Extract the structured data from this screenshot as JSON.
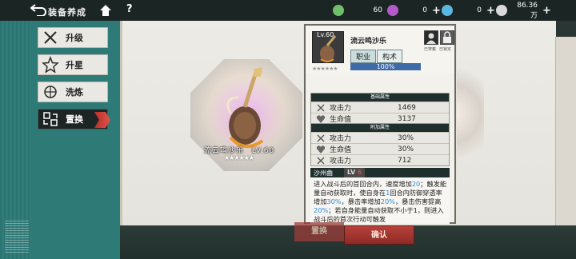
{
  "topbar": {
    "title": "装备养成",
    "help": "?",
    "resources": [
      {
        "name": "jade",
        "value": "60",
        "color": "#6fbf6a"
      },
      {
        "name": "token",
        "value": "0",
        "color": "#b25ac9"
      },
      {
        "name": "gem",
        "value": "0",
        "color": "#5cb7e0"
      },
      {
        "name": "coin",
        "value": "86.36万",
        "color": "#d9d9d9"
      }
    ],
    "plus": "+"
  },
  "sidebar": {
    "items": [
      {
        "label": "升级",
        "icon": "crossed-swords-icon",
        "active": false
      },
      {
        "label": "升星",
        "icon": "star-icon",
        "active": false
      },
      {
        "label": "洗炼",
        "icon": "refine-icon",
        "active": false
      },
      {
        "label": "置换",
        "icon": "swap-icon",
        "active": true
      }
    ]
  },
  "preview": {
    "name": "流云鸣沙乐",
    "level": "LV.60",
    "stars": "★★★★★★"
  },
  "panel": {
    "level": "Lv.60",
    "name": "流云鸣沙乐",
    "job_label": "职业",
    "job_value": "构术",
    "progress_text": "100%",
    "progress": 1.0,
    "avatars": [
      {
        "caption": "已穿戴"
      },
      {
        "caption": "已锁定"
      }
    ],
    "base_title": "基础属性",
    "base_stats": [
      {
        "name": "攻击力",
        "value": "1469",
        "icon": "sword-icon"
      },
      {
        "name": "生命值",
        "value": "3137",
        "icon": "heart-icon"
      }
    ],
    "extra_title": "附加属性",
    "extra_stats": [
      {
        "name": "攻击力",
        "value": "30%",
        "icon": "sword-icon"
      },
      {
        "name": "生命值",
        "value": "30%",
        "icon": "heart-icon"
      },
      {
        "name": "攻击力",
        "value": "712",
        "icon": "sword-icon"
      }
    ],
    "skill_name": "沙州曲",
    "skill_level_prefix": "LV ",
    "skill_level": "6",
    "skill_desc": [
      {
        "t": "进入战斗后的首回合内，速度增加"
      },
      {
        "t": "20",
        "hl": true
      },
      {
        "t": "；触发能量自动获取时，使自身在"
      },
      {
        "t": "1",
        "hl": true
      },
      {
        "t": "回合内防御穿透率增加"
      },
      {
        "t": "30%",
        "hl": true
      },
      {
        "t": "，暴击率增加"
      },
      {
        "t": "20%",
        "hl": true
      },
      {
        "t": "，暴击伤害提高"
      },
      {
        "t": "20%",
        "hl": true
      },
      {
        "t": "；若自身能量自动获取不小于"
      },
      {
        "t": "",
        "hl": false
      },
      {
        "t": "1，则进入战斗后的首次行动可触发"
      }
    ]
  },
  "buttons": {
    "swap": "置换",
    "confirm": "确认"
  }
}
